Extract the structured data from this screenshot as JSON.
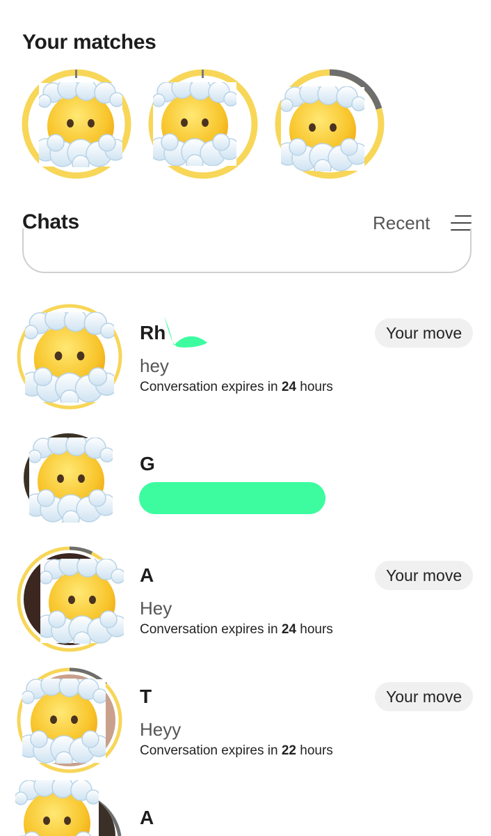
{
  "matches": {
    "title": "Your matches",
    "items": [
      {
        "progress": 0.98,
        "avatar_icon": "face-in-clouds-icon"
      },
      {
        "progress": 0.98,
        "avatar_icon": "face-in-clouds-icon"
      },
      {
        "progress": 0.75,
        "avatar_icon": "face-in-clouds-icon"
      }
    ]
  },
  "chats": {
    "title": "Chats",
    "sort_label": "Recent",
    "items": [
      {
        "name": "Rh",
        "message": "hey",
        "expiry_prefix": "Conversation expires in ",
        "expiry_value": "24",
        "expiry_suffix": " hours",
        "badge": "Your move",
        "avatar_icon": "face-in-clouds-icon"
      },
      {
        "name": "G",
        "message": "",
        "avatar_icon": "face-in-clouds-icon"
      },
      {
        "name": "A",
        "message": "Hey",
        "expiry_prefix": "Conversation expires in ",
        "expiry_value": "24",
        "expiry_suffix": " hours",
        "badge": "Your move",
        "avatar_icon": "face-in-clouds-icon"
      },
      {
        "name": "T",
        "message": "Heyy",
        "expiry_prefix": "Conversation expires in ",
        "expiry_value": "22",
        "expiry_suffix": " hours",
        "badge": "Your move",
        "avatar_icon": "face-in-clouds-icon"
      },
      {
        "name": "A",
        "avatar_icon": "face-in-clouds-icon"
      }
    ]
  },
  "colors": {
    "ring": "#f7d658",
    "ring_track": "#7a7a7a",
    "badge_bg": "#f0f0f0",
    "scribble": "#3dfca0"
  }
}
